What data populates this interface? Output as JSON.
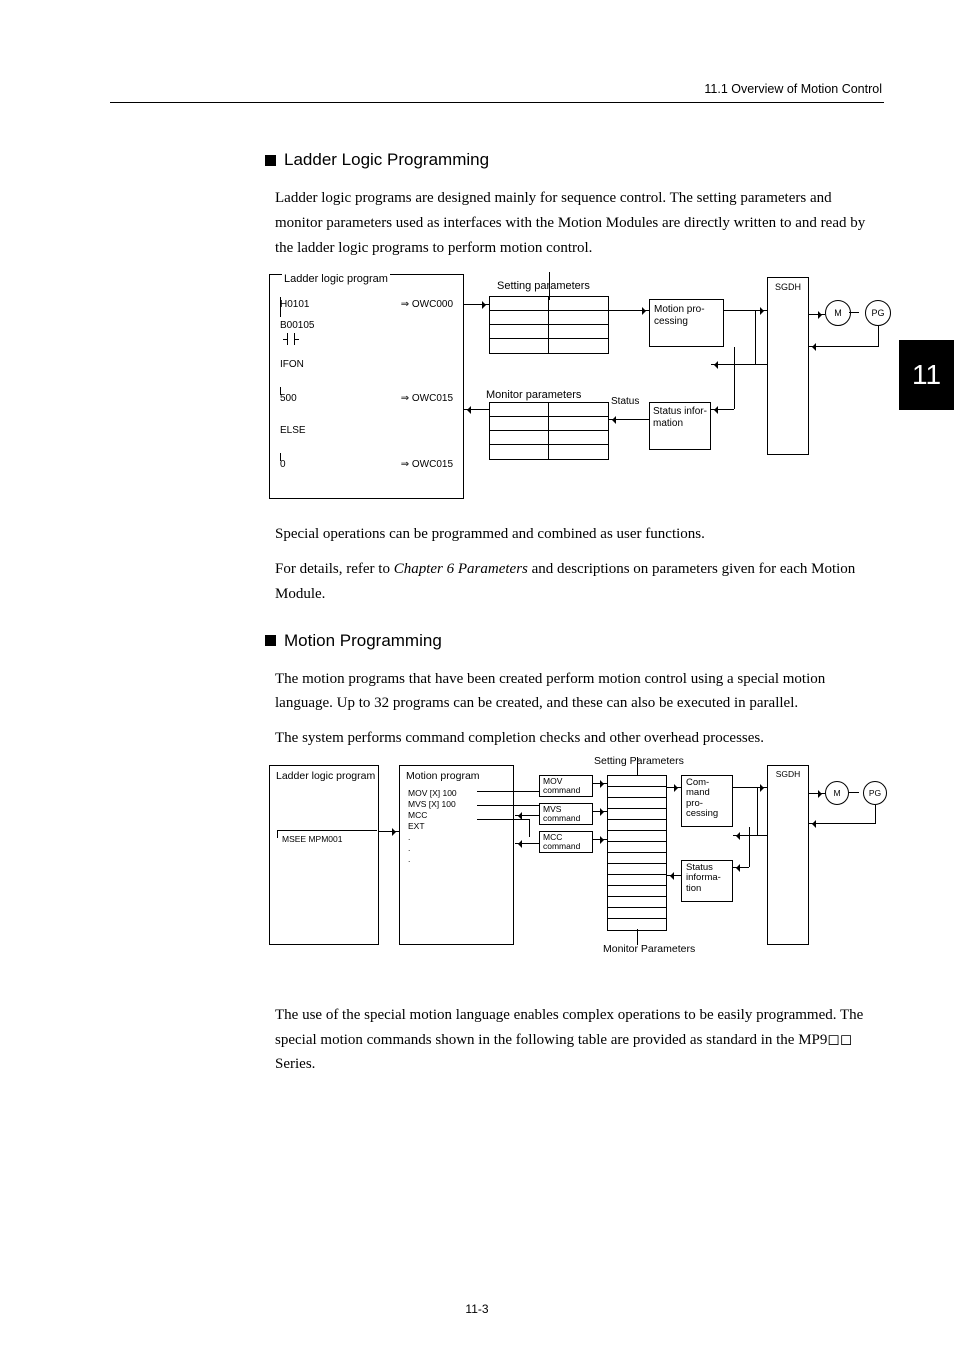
{
  "header": "11.1  Overview of Motion Control",
  "chapter_tab": "11",
  "section1": {
    "title": "Ladder Logic Programming",
    "para1": "Ladder logic programs are designed mainly for sequence control. The setting parameters and monitor parameters used as interfaces with the Motion Modules are directly written to and read by the ladder logic programs to perform motion control.",
    "para2": "Special operations can be programmed and combined as user functions.",
    "para3a": "For details, refer to ",
    "para3b": "Chapter 6 Parameters",
    "para3c": " and descriptions on parameters given for each Motion Module."
  },
  "diagram1": {
    "ladder_title": "Ladder logic program",
    "items": [
      "H0101",
      "B00105",
      "IFON",
      "500",
      "ELSE",
      "0"
    ],
    "rhs": [
      "⇒ OWC000",
      "",
      "",
      "⇒ OWC015",
      "",
      "⇒ OWC015"
    ],
    "setting_title": "Setting parameters",
    "monitor_title": "Monitor parameters",
    "motion_proc": "Motion pro-cessing",
    "status_label": "Status",
    "status_info": "Status infor-mation",
    "sgdh": "SGDH",
    "m": "M",
    "pg": "PG"
  },
  "section2": {
    "title": "Motion Programming",
    "para1": "The motion programs that have been created perform motion control using a special motion language. Up to 32 programs can be created, and these can also be executed in parallel.",
    "para2": "The system performs command completion checks and other overhead processes.",
    "para3": "The use of the special motion language enables complex operations to be easily programmed. The special motion commands shown in the following table are provided as standard in the MP9◻◻ Series."
  },
  "diagram2": {
    "ladder_title": "Ladder logic program",
    "msee": "MSEE MPM001",
    "motion_title": "Motion program",
    "motion_lines": "MOV [X] 100\nMVS [X] 100\nMCC\nEXT\n.\n.\n.",
    "cmds": [
      "MOV command",
      "MVS command",
      "MCC command"
    ],
    "setting_title": "Setting Parameters",
    "monitor_title": "Monitor Parameters",
    "cmd_proc": "Com-mand pro-cessing",
    "status_info": "Status informa-tion",
    "sgdh": "SGDH",
    "m": "M",
    "pg": "PG"
  },
  "page_number": "11-3"
}
